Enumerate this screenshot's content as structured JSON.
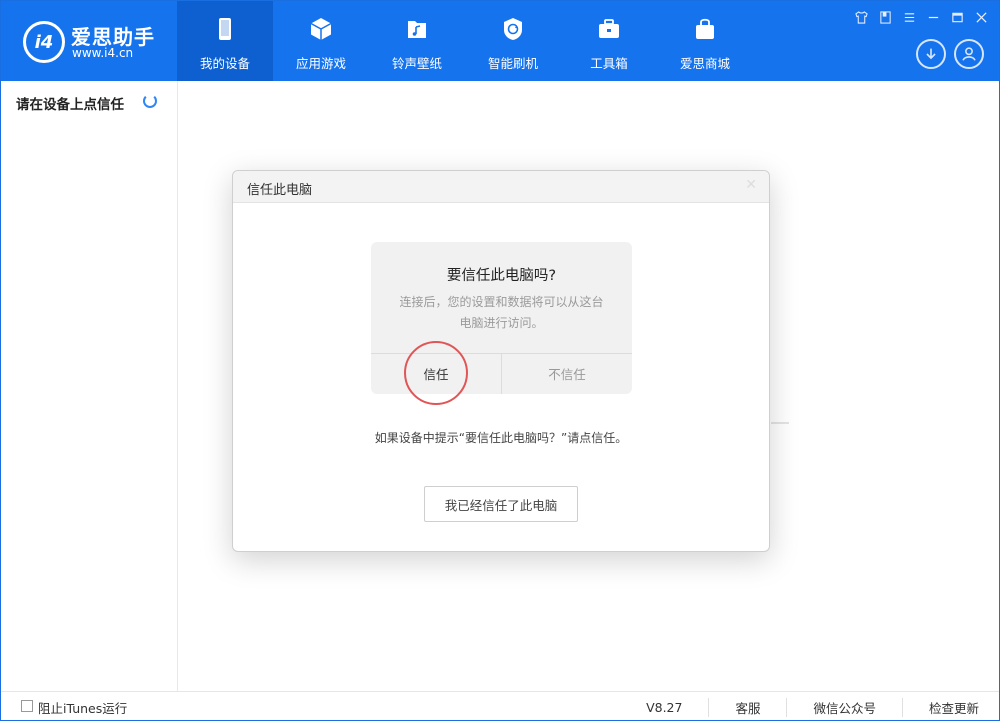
{
  "app": {
    "brand_name": "爱思助手",
    "brand_url": "www.i4.cn",
    "logo_text": "i4",
    "accent_color": "#1673ee"
  },
  "nav": {
    "items": [
      {
        "label": "我的设备",
        "icon": "phone-icon",
        "active": true
      },
      {
        "label": "应用游戏",
        "icon": "cube-icon"
      },
      {
        "label": "铃声壁纸",
        "icon": "music-folder-icon"
      },
      {
        "label": "智能刷机",
        "icon": "refresh-shield-icon"
      },
      {
        "label": "工具箱",
        "icon": "toolbox-icon"
      },
      {
        "label": "爱思商城",
        "icon": "shopping-bag-icon"
      }
    ]
  },
  "window_controls": [
    "shirt-icon",
    "book-icon",
    "menu-icon",
    "minimize-icon",
    "maximize-icon",
    "close-icon"
  ],
  "sidebar": {
    "status_text": "请在设备上点信任"
  },
  "dialog": {
    "title": "信任此电脑",
    "prompt": {
      "title": "要信任此电脑吗?",
      "text": "连接后，您的设置和数据将可以从这台电脑进行访问。",
      "trust_label": "信任",
      "distrust_label": "不信任"
    },
    "hint": "如果设备中提示“要信任此电脑吗？”请点信任。",
    "confirm_label": "我已经信任了此电脑"
  },
  "footer": {
    "checkbox_label": "阻止iTunes运行",
    "version": "V8.27",
    "links": [
      "客服",
      "微信公众号",
      "检查更新"
    ]
  }
}
